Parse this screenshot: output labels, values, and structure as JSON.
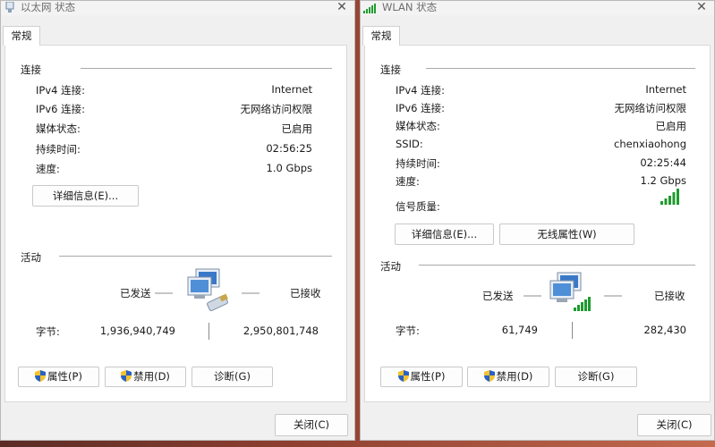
{
  "ethernet": {
    "title": "以太网 状态",
    "tab": "常规",
    "connection_header": "连接",
    "rows": [
      {
        "label": "IPv4 连接:",
        "value": "Internet"
      },
      {
        "label": "IPv6 连接:",
        "value": "无网络访问权限"
      },
      {
        "label": "媒体状态:",
        "value": "已启用"
      },
      {
        "label": "持续时间:",
        "value": "02:56:25"
      },
      {
        "label": "速度:",
        "value": "1.0 Gbps"
      }
    ],
    "details_button": "详细信息(E)...",
    "activity_header": "活动",
    "sent_label": "已发送",
    "received_label": "已接收",
    "bytes_label": "字节:",
    "bytes_sent": "1,936,940,749",
    "bytes_received": "2,950,801,748",
    "properties_button": "属性(P)",
    "disable_button": "禁用(D)",
    "diagnose_button": "诊断(G)",
    "close_button": "关闭(C)"
  },
  "wlan": {
    "title": "WLAN 状态",
    "tab": "常规",
    "connection_header": "连接",
    "rows": [
      {
        "label": "IPv4 连接:",
        "value": "Internet"
      },
      {
        "label": "IPv6 连接:",
        "value": "无网络访问权限"
      },
      {
        "label": "媒体状态:",
        "value": "已启用"
      },
      {
        "label": "SSID:",
        "value": "chenxiaohong"
      },
      {
        "label": "持续时间:",
        "value": "02:25:44"
      },
      {
        "label": "速度:",
        "value": "1.2 Gbps"
      }
    ],
    "signal_label": "信号质量:",
    "signal_bars": 5,
    "details_button": "详细信息(E)...",
    "wireless_props_button": "无线属性(W)",
    "activity_header": "活动",
    "sent_label": "已发送",
    "received_label": "已接收",
    "bytes_label": "字节:",
    "bytes_sent": "61,749",
    "bytes_received": "282,430",
    "properties_button": "属性(P)",
    "disable_button": "禁用(D)",
    "diagnose_button": "诊断(G)",
    "close_button": "关闭(C)"
  },
  "icons": {
    "close": "✕",
    "ethernet_title_icon": "ethernet-adapter-icon",
    "wlan_title_icon": "wifi-signal-icon",
    "shield": "uac-shield-icon",
    "network_activity": "computer-network-icon"
  },
  "colors": {
    "signal_green": "#1f9b2e",
    "monitor_blue": "#3a78c8"
  }
}
